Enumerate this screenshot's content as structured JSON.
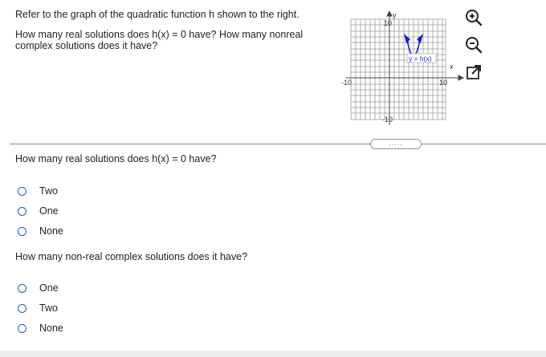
{
  "prompt": {
    "intro": "Refer to the graph of the quadratic function h shown to the right.",
    "question": "How many real solutions does h(x) = 0 have? How many nonreal complex solutions does it have?"
  },
  "graph": {
    "y_axis_label": "y",
    "x_axis_label": "x",
    "function_label": "y = h(x)",
    "tick_top": "10",
    "tick_bottom": "-10",
    "tick_left": "-10",
    "tick_right": "10",
    "line_color": "#1c1ccf"
  },
  "toolbar": {
    "zoom_in_icon": "zoom-in-icon",
    "zoom_out_icon": "zoom-out-icon",
    "popout_icon": "popout-icon"
  },
  "more_button": ".....",
  "q1": {
    "title": "How many real solutions does h(x) = 0 have?",
    "options": [
      "Two",
      "One",
      "None"
    ]
  },
  "q2": {
    "title": "How many non-real complex solutions does it have?",
    "options": [
      "One",
      "Two",
      "None"
    ]
  }
}
